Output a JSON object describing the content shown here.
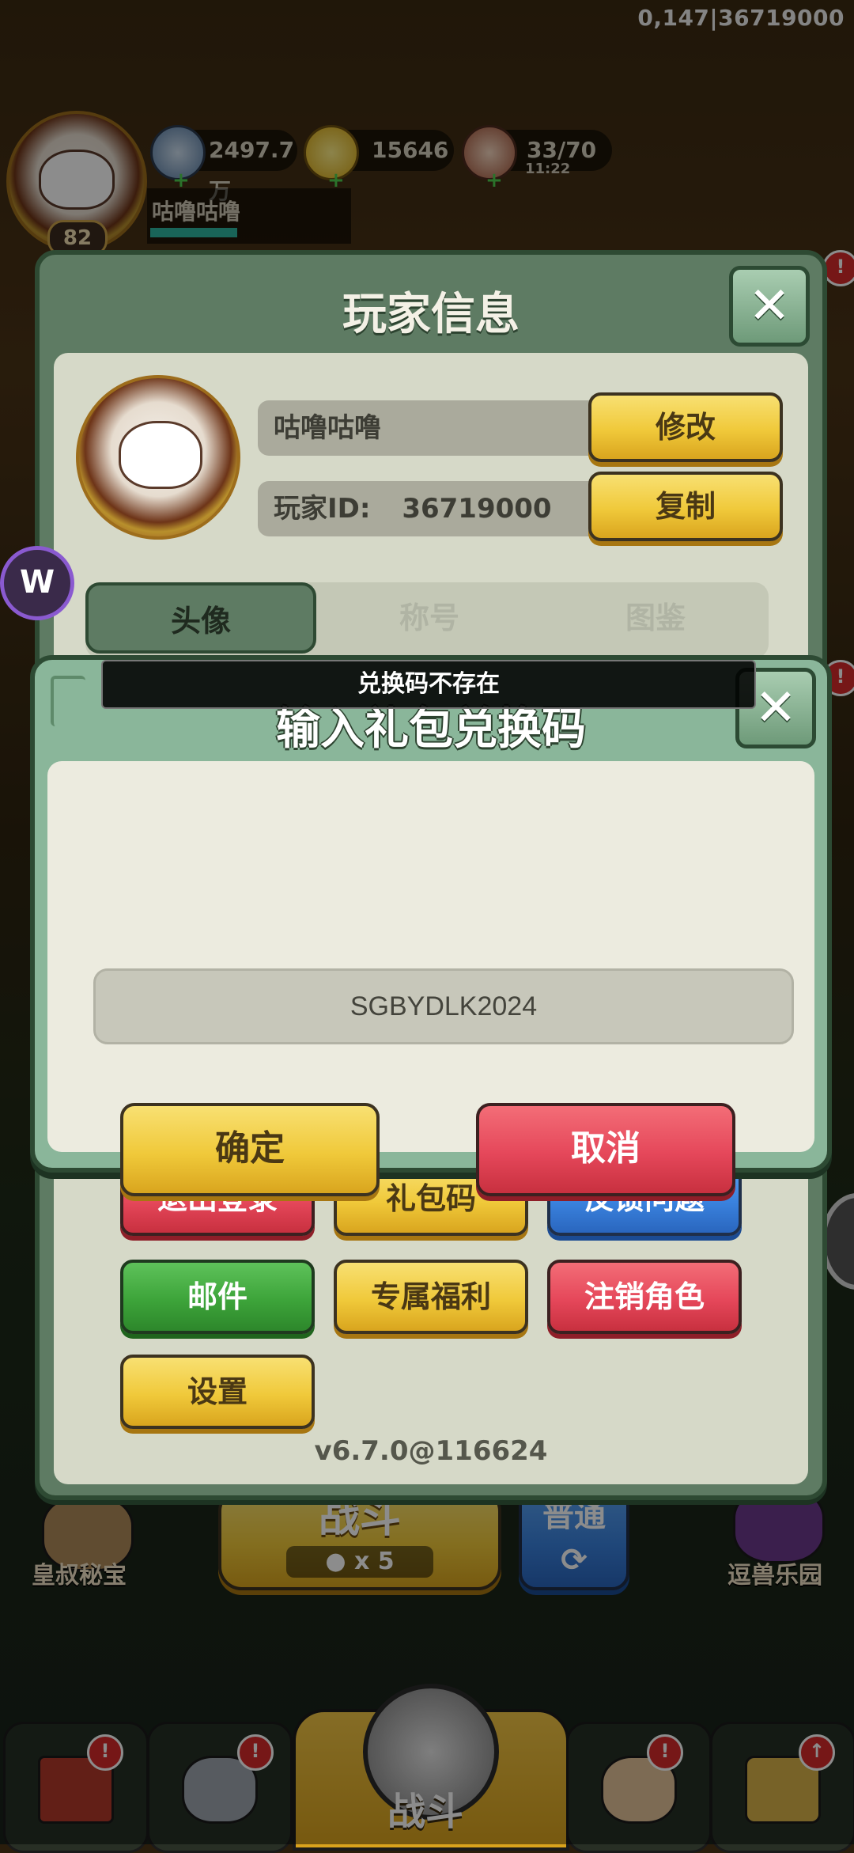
{
  "debug_text": "0,147|36719000",
  "topbar": {
    "level": "82",
    "silver": "2497.7万",
    "gold": "15646",
    "stamina": "33/70",
    "stamina_timer": "11:22",
    "player_name": "咕噜咕噜"
  },
  "player_info": {
    "title": "玩家信息",
    "name_value": "咕噜咕噜",
    "id_label": "玩家ID:",
    "id_value": "36719000",
    "modify_label": "修改",
    "copy_label": "复制",
    "tabs": [
      {
        "label": "头像"
      },
      {
        "label": "称号"
      },
      {
        "label": "图鉴"
      }
    ],
    "actions": [
      {
        "label": "退出登录"
      },
      {
        "label": "礼包码"
      },
      {
        "label": "反馈问题"
      },
      {
        "label": "邮件"
      },
      {
        "label": "专属福利"
      },
      {
        "label": "注销角色"
      },
      {
        "label": "设置"
      }
    ],
    "version": "v6.7.0@116624"
  },
  "modal": {
    "title": "输入礼包兑换码",
    "toast": "兑换码不存在",
    "code_value": "SGBYDLK2024",
    "confirm_label": "确定",
    "cancel_label": "取消"
  },
  "scene": {
    "left_label": "皇叔秘宝",
    "right_label": "逗兽乐园",
    "battle_label": "战斗",
    "battle_cost": "x 5",
    "mode_label": "普通",
    "dock_battle_label": "战斗"
  },
  "colors": {
    "panel_green": "#5e7b63",
    "modal_green": "#8ab69a",
    "button_yellow": "#f0c93a",
    "button_red": "#e5475a",
    "button_blue": "#3a82de",
    "button_green": "#3da43a"
  }
}
